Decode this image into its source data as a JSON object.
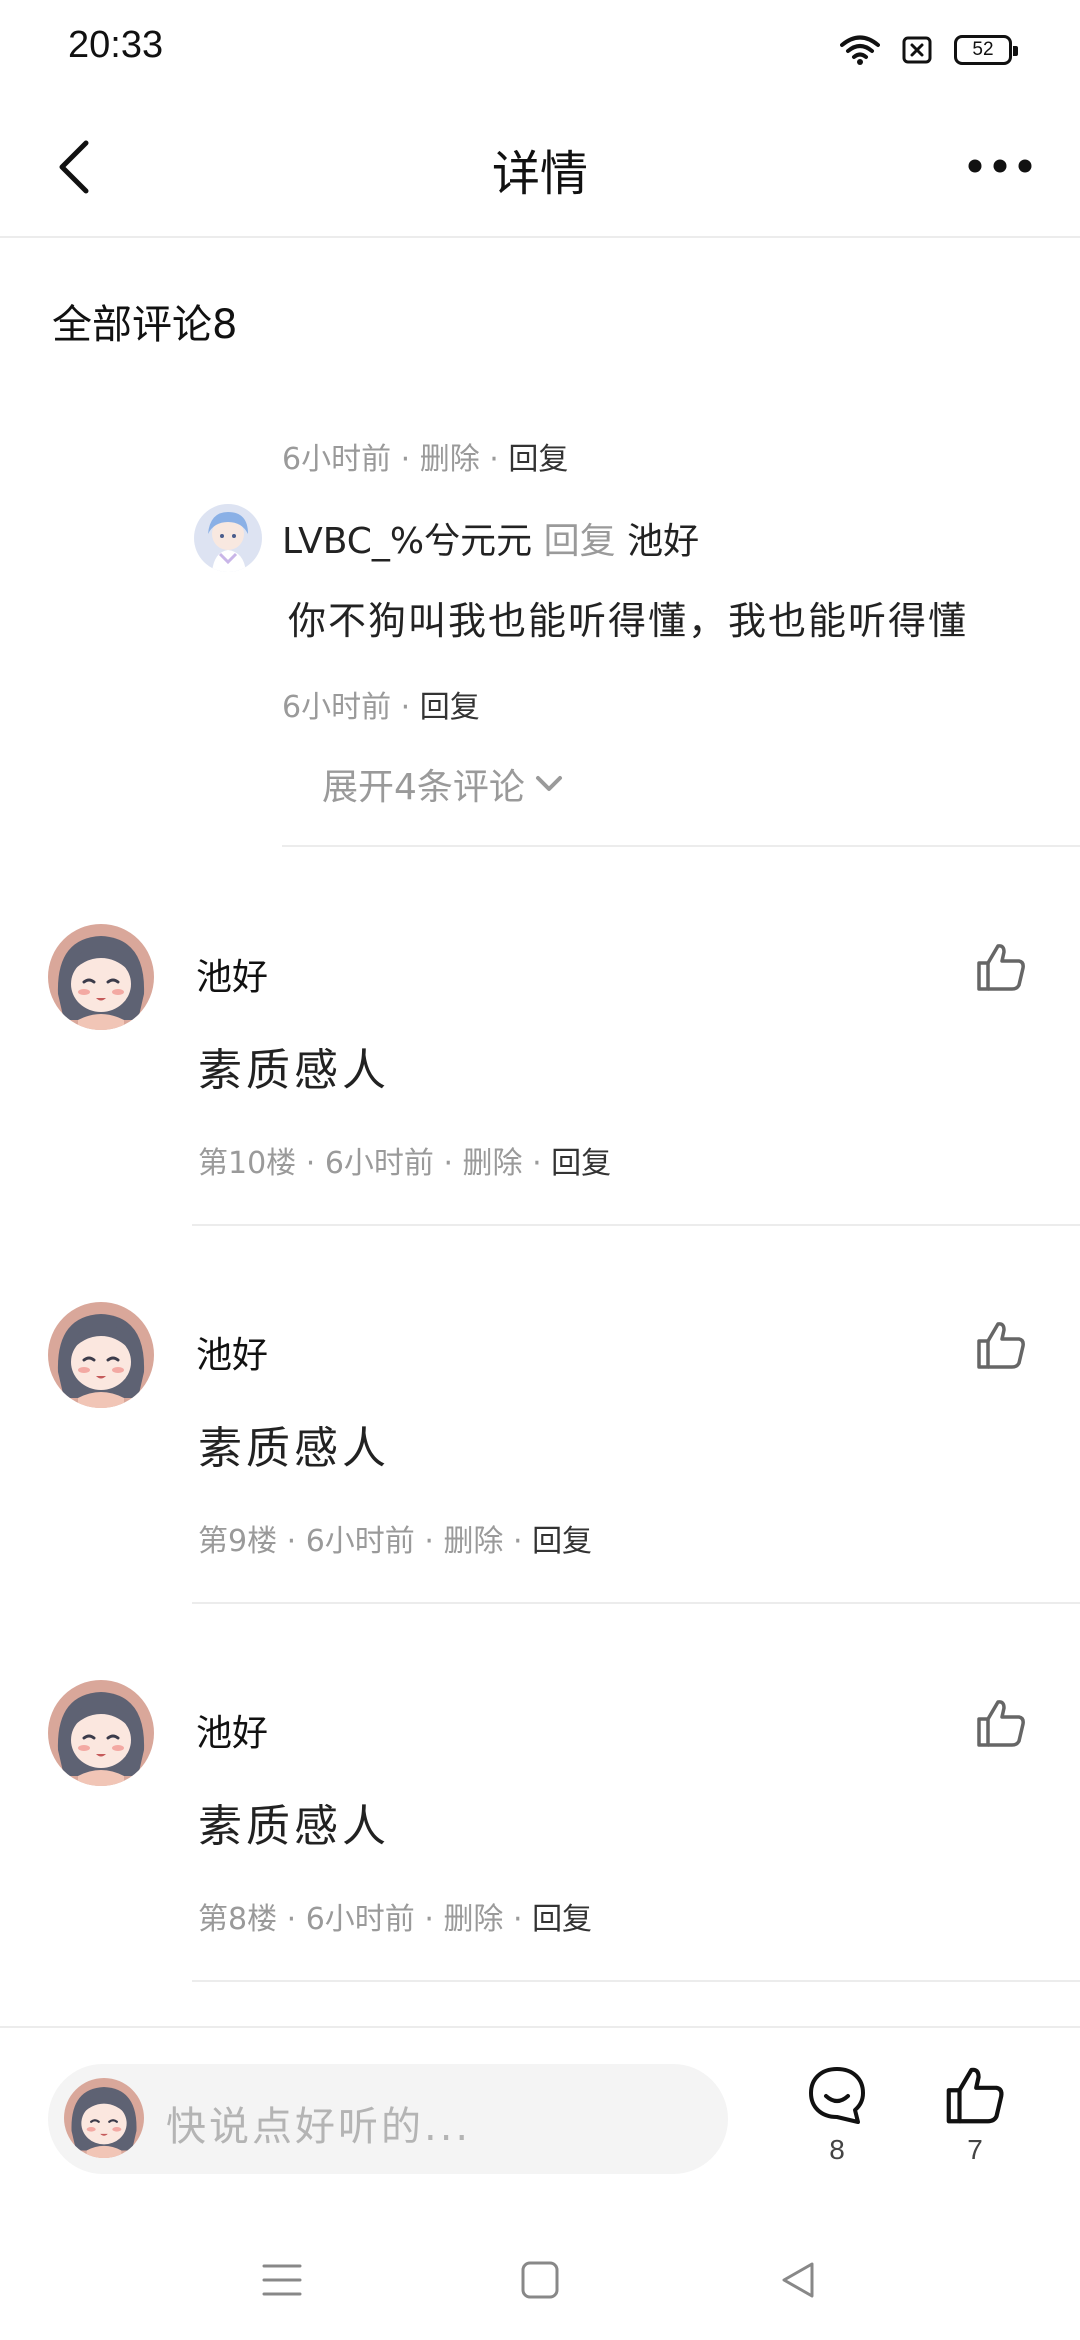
{
  "status_bar": {
    "time": "20:33",
    "battery": "52"
  },
  "header": {
    "title": "详情"
  },
  "comments_section": {
    "heading": "全部评论8"
  },
  "reply": {
    "meta_top": {
      "time": "6小时前",
      "delete": "删除",
      "reply": "回复"
    },
    "author": "LVBC_%兮元元",
    "reply_word": "回复",
    "target": "池好",
    "text": "你不狗叫我也能听得懂，我也能听得懂",
    "meta_bottom": {
      "time": "6小时前",
      "reply": "回复"
    },
    "expand_label": "展开4条评论"
  },
  "comments": [
    {
      "name": "池好",
      "text": "素质感人",
      "floor": "第10楼",
      "time": "6小时前",
      "delete": "删除",
      "reply": "回复"
    },
    {
      "name": "池好",
      "text": "素质感人",
      "floor": "第9楼",
      "time": "6小时前",
      "delete": "删除",
      "reply": "回复"
    },
    {
      "name": "池好",
      "text": "素质感人",
      "floor": "第8楼",
      "time": "6小时前",
      "delete": "删除",
      "reply": "回复"
    }
  ],
  "bottom_bar": {
    "placeholder": "快说点好听的...",
    "comment_count": "8",
    "like_count": "7"
  },
  "icons": {
    "back": "chevron-left-icon",
    "more": "more-horizontal-icon",
    "like": "thumbs-up-icon",
    "comment": "comment-bubble-icon",
    "expand": "chevron-down-icon"
  }
}
